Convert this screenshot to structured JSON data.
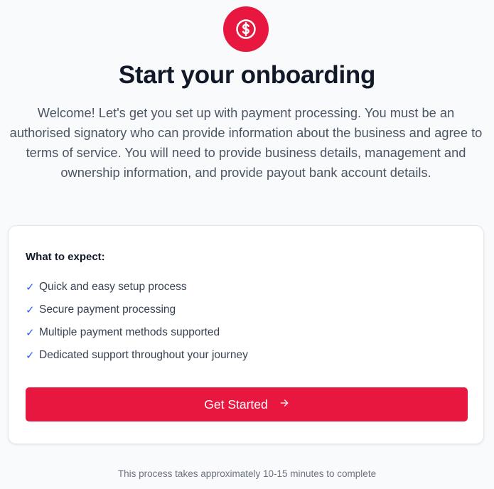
{
  "header": {
    "icon": "dollar-circle-icon",
    "title": "Start your onboarding",
    "intro": "Welcome! Let's get you set up with payment processing. You must be an authorised signatory who can provide information about the business and agree to terms of service. You will need to provide business details, management and ownership information, and provide payout bank account details."
  },
  "card": {
    "heading": "What to expect:",
    "check_glyph": "✓",
    "items": [
      "Quick and easy setup process",
      "Secure payment processing",
      "Multiple payment methods supported",
      "Dedicated support throughout your journey"
    ],
    "cta_label": "Get Started",
    "cta_icon": "arrow-right-icon"
  },
  "footer": {
    "note": "This process takes approximately 10-15 minutes to complete"
  },
  "colors": {
    "brand": "#e8173f",
    "check": "#2563eb",
    "background": "#f9fafb"
  }
}
